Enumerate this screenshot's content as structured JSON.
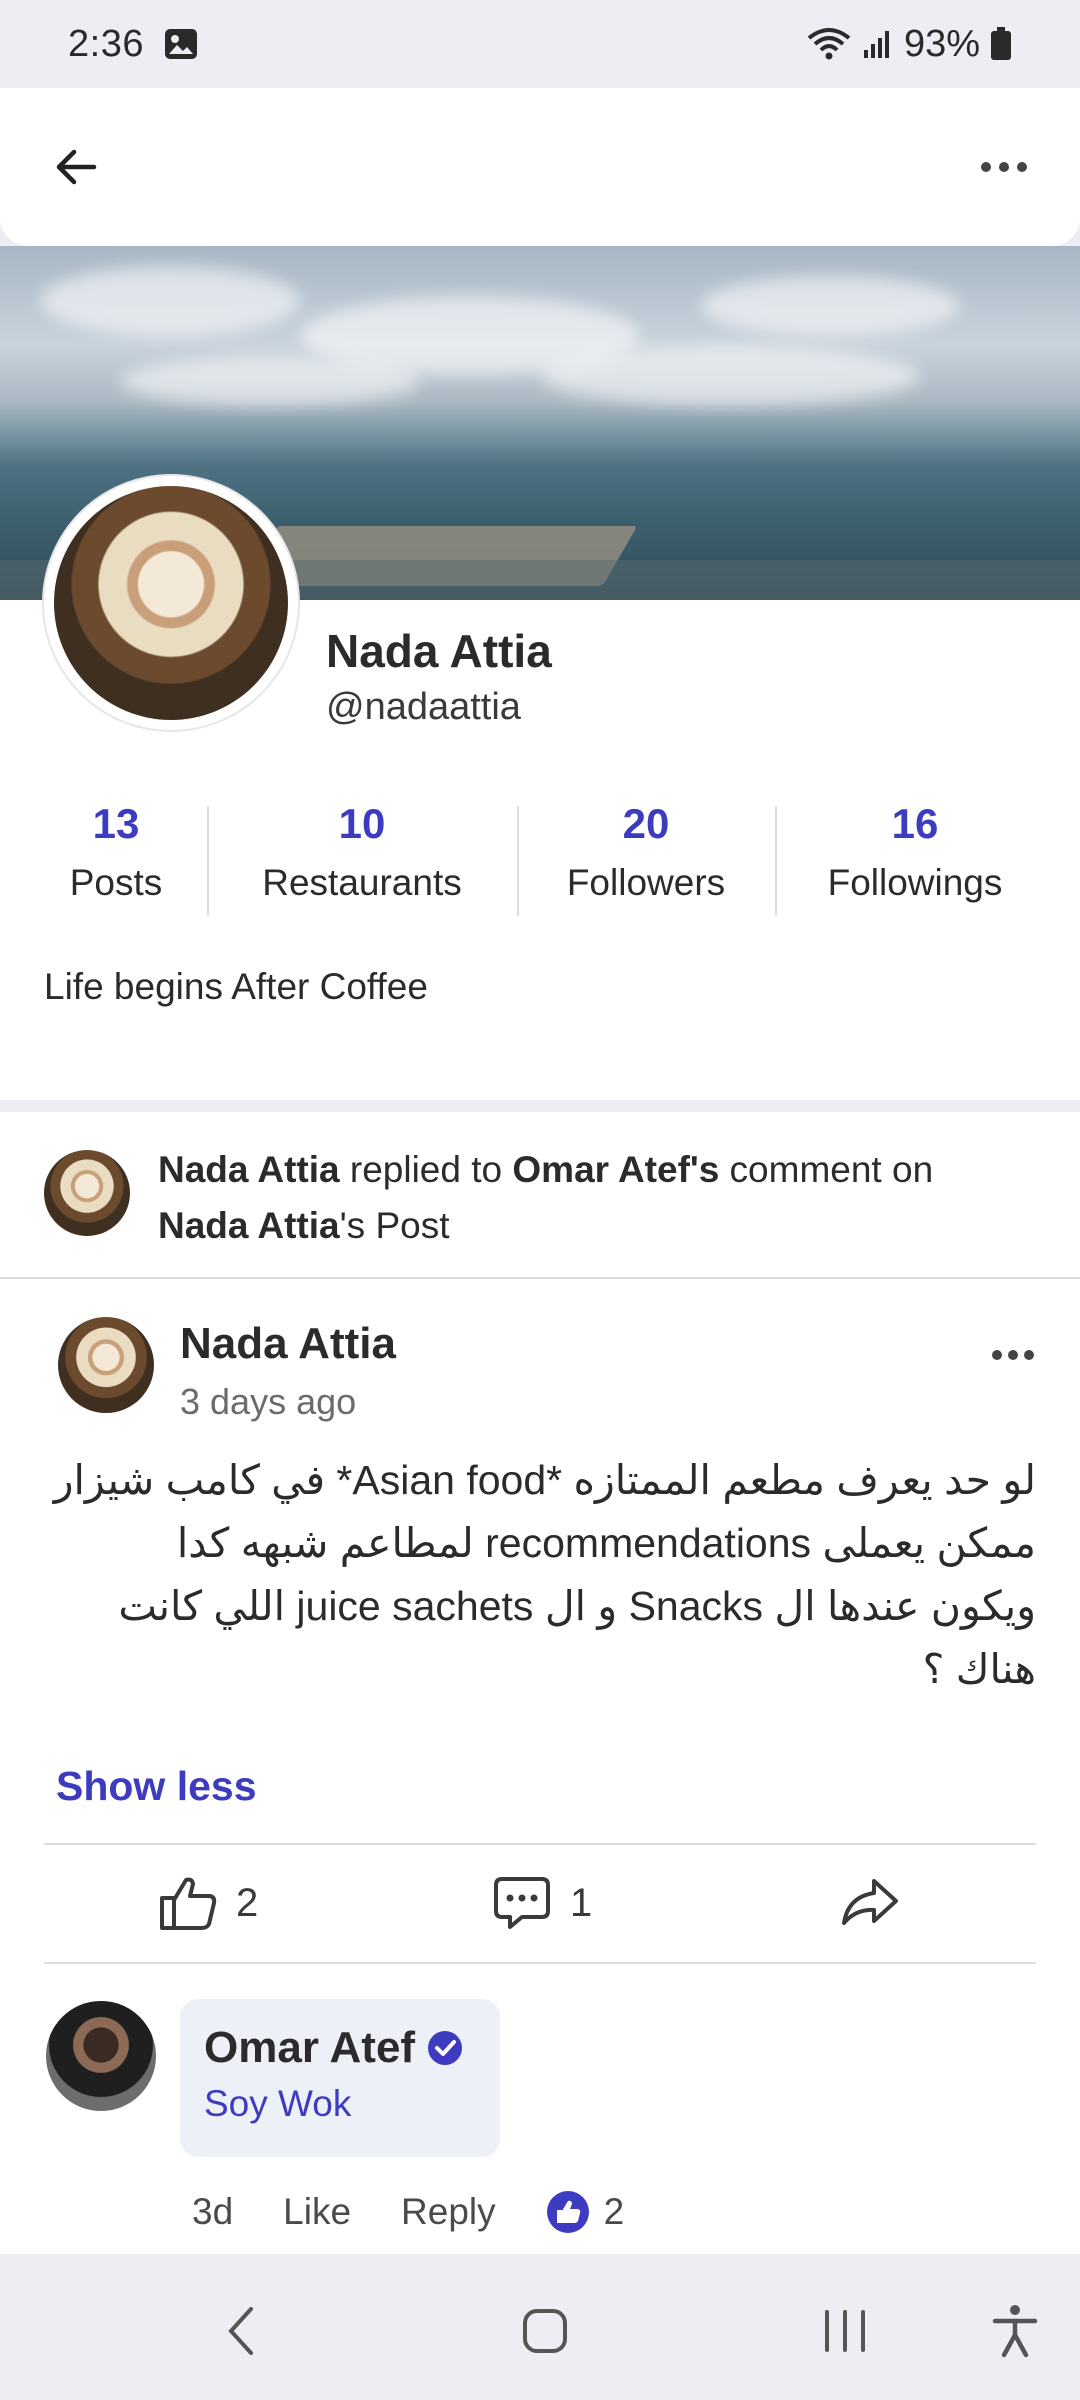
{
  "status_bar": {
    "time": "2:36",
    "battery": "93%",
    "icons": [
      "image-icon",
      "wifi-icon",
      "signal-icon",
      "battery-icon"
    ]
  },
  "app_bar": {
    "back_icon": "arrow-left-icon",
    "more_icon": "more-horizontal-icon"
  },
  "profile": {
    "name": "Nada Attia",
    "handle": "@nadaattia",
    "bio": "Life begins After Coffee",
    "stats": [
      {
        "value": "13",
        "label": "Posts"
      },
      {
        "value": "10",
        "label": "Restaurants"
      },
      {
        "value": "20",
        "label": "Followers"
      },
      {
        "value": "16",
        "label": "Followings"
      }
    ]
  },
  "activity": {
    "actor": "Nada Attia",
    "verb": " replied to ",
    "target": "Omar Atef's",
    "middle": " comment on ",
    "owner": "Nada Attia",
    "suffix": "'s Post"
  },
  "post": {
    "author": "Nada Attia",
    "time": "3 days ago",
    "body_lines": [
      "لو حد يعرف مطعم الممتازه *Asian food* في كامب شيزار",
      "ممكن يعملى recommendations لمطاعم شبهه كدا",
      "ويكون عندها ال Snacks و ال juice sachets اللي كانت",
      "هناك ؟"
    ],
    "show_less": "Show less",
    "likes": "2",
    "comments": "1"
  },
  "comment": {
    "author": "Omar Atef",
    "text": "Soy Wok",
    "age": "3d",
    "like_label": "Like",
    "reply_label": "Reply",
    "likes": "2"
  },
  "colors": {
    "accent": "#3d3bbf",
    "background": "#eceef3",
    "card": "#ffffff"
  }
}
